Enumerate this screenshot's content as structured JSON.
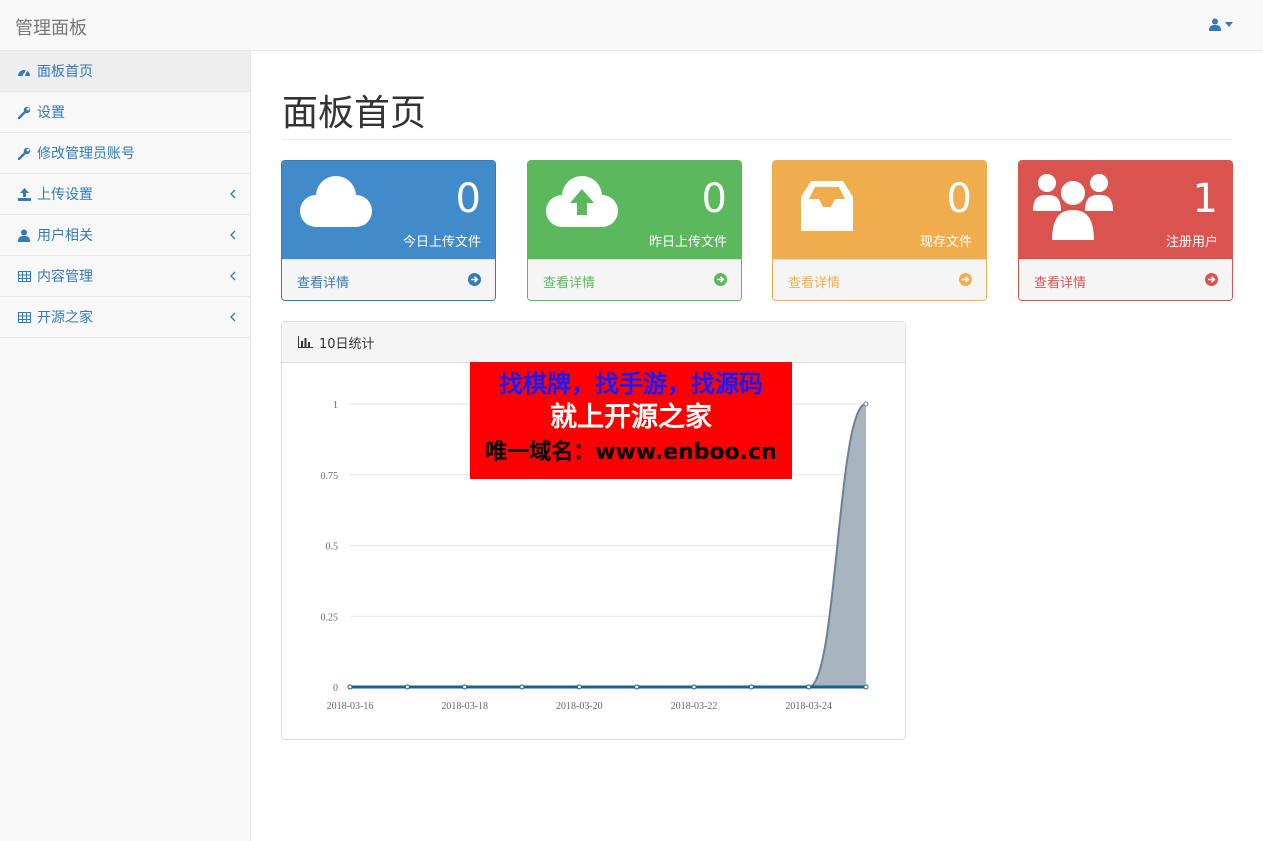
{
  "app": {
    "brand": "管理面板"
  },
  "colors": {
    "blue": "#428bca",
    "green": "#5cb85c",
    "yellow": "#f0ad4e",
    "red": "#d9534f",
    "link": "#337ab7"
  },
  "header": {
    "user_icon": "user-icon"
  },
  "sidebar": {
    "items": [
      {
        "label": "面板首页",
        "icon": "dashboard-icon",
        "active": true,
        "has_submenu": false
      },
      {
        "label": "设置",
        "icon": "wrench-icon",
        "active": false,
        "has_submenu": false
      },
      {
        "label": "修改管理员账号",
        "icon": "wrench-icon",
        "active": false,
        "has_submenu": false
      },
      {
        "label": "上传设置",
        "icon": "upload-icon",
        "active": false,
        "has_submenu": true
      },
      {
        "label": "用户相关",
        "icon": "user-icon",
        "active": false,
        "has_submenu": true
      },
      {
        "label": "内容管理",
        "icon": "table-icon",
        "active": false,
        "has_submenu": true
      },
      {
        "label": "开源之家",
        "icon": "table-icon",
        "active": false,
        "has_submenu": true
      }
    ]
  },
  "main": {
    "title": "面板首页",
    "cards": [
      {
        "value": "0",
        "label": "今日上传文件",
        "link": "查看详情",
        "icon": "cloud-icon"
      },
      {
        "value": "0",
        "label": "昨日上传文件",
        "link": "查看详情",
        "icon": "cloud-upload-icon"
      },
      {
        "value": "0",
        "label": "现存文件",
        "link": "查看详情",
        "icon": "inbox-icon"
      },
      {
        "value": "1",
        "label": "注册用户",
        "link": "查看详情",
        "icon": "users-icon"
      }
    ],
    "chart_panel": {
      "title": "10日统计",
      "icon": "bar-chart-icon"
    }
  },
  "ad": {
    "line1": "找棋牌，找手游，找源码",
    "line2": "就上开源之家",
    "line3": "唯一域名：www.enboo.cn"
  },
  "chart_data": {
    "type": "area",
    "title": "",
    "xlabel": "",
    "ylabel": "",
    "x": [
      "2018-03-16",
      "2018-03-17",
      "2018-03-18",
      "2018-03-19",
      "2018-03-20",
      "2018-03-21",
      "2018-03-22",
      "2018-03-23",
      "2018-03-24",
      "2018-03-25"
    ],
    "x_tick_labels": [
      "2018-03-16",
      "2018-03-18",
      "2018-03-20",
      "2018-03-22",
      "2018-03-24"
    ],
    "y_tick_labels": [
      "0",
      "0.25",
      "0.5",
      "0.75",
      "1"
    ],
    "ylim": [
      0,
      1
    ],
    "grid": true,
    "series": [
      {
        "values": [
          0,
          0,
          0,
          0,
          0,
          0,
          0,
          0,
          0,
          1
        ],
        "color": "#6a8293",
        "fill": "#a3b1bb"
      },
      {
        "values": [
          0,
          0,
          0,
          0,
          0,
          0,
          0,
          0,
          0,
          0
        ],
        "color": "#1f5f8b",
        "fill": "#1f5f8b"
      }
    ]
  }
}
